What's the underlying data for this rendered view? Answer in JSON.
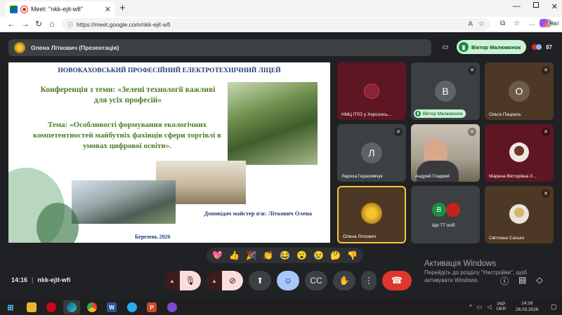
{
  "browser": {
    "tab_title": "Meet: \"nkk-ejit-wfi\"",
    "tab_close": "✕",
    "new_tab": "+",
    "url": "https://meet.google.com/nkk-ejit-wfi",
    "chat_label": "Чат",
    "icons": [
      "back-icon",
      "forward-icon",
      "refresh-icon",
      "home-icon",
      "info-icon",
      "read-aloud-icon",
      "favorite-icon",
      "split-screen-icon",
      "favorites-icon",
      "collections-icon",
      "more-icon",
      "profile-icon",
      "copilot-icon",
      "minimize-icon",
      "maximize-icon",
      "close-icon"
    ]
  },
  "meet": {
    "presenter_label": "Олена Літкович (Презентація)",
    "active_speaker": "Віктор Малюжонок",
    "participant_count": "87",
    "meeting_time": "14:16",
    "meeting_code": "nkk-ejit-wfi",
    "separator": "|"
  },
  "slide": {
    "header": "НОВОКАХОВСЬКИЙ ПРОФЕСІЙНИЙ ЕЛЕКТРОТЕХНІЧНИЙ ЛІЦЕЙ",
    "conference": "Конференція з теми: «Зелені технології важливі для усіх професій»",
    "topic": "Тема: «Особливості формування екологічних компетентностей майбутніх фахівців сфери торгівлі в умовах цифрової освіти».",
    "reporter": "Доповідач майстер в\\н: Літкович Олена",
    "date": "Березень 2026"
  },
  "participants": [
    {
      "name": "НМЦ ПТО у Херсонсь...",
      "initial": "",
      "muted": false
    },
    {
      "name": "Віктор Малюжонок",
      "initial": "В",
      "muted": true
    },
    {
      "name": "Ольга Пацкаль",
      "initial": "О",
      "muted": true
    },
    {
      "name": "Лариса Герасимчук",
      "initial": "Л",
      "muted": true
    },
    {
      "name": "Андрей Гладкий",
      "initial": "",
      "muted": true
    },
    {
      "name": "Марина Вікторівна Х...",
      "initial": "",
      "muted": true
    },
    {
      "name": "Олена Літкович",
      "initial": "",
      "muted": false
    },
    {
      "name": "Ще 77 осіб",
      "initial": "В",
      "muted": false
    },
    {
      "name": "Світлана Сасько",
      "initial": "",
      "muted": true
    }
  ],
  "reactions": [
    "💖",
    "👍",
    "🎉",
    "👏",
    "😂",
    "😮",
    "😢",
    "🤔",
    "👎"
  ],
  "activation": {
    "title": "Активація Windows",
    "line1": "Перейдіть до розділу \"Настройки\", щоб",
    "line2": "активувати Windows."
  },
  "taskbar": {
    "lang_top": "УКР",
    "lang_bottom": "UKR",
    "time": "14:16",
    "date": "26.03.2026",
    "chevron": "^"
  },
  "colors": {
    "meet_bg": "#202124",
    "end_call": "#dc362e",
    "reaction_active": "#a8c7fa",
    "speaker_green": "#c9f3d5",
    "slide_title_blue": "#1f3b73",
    "slide_text_green": "#4c7a25"
  }
}
